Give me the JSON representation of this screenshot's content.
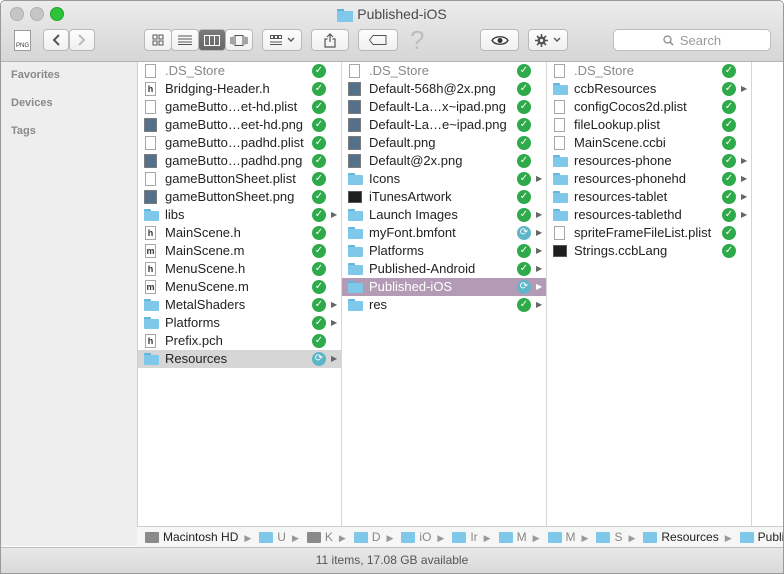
{
  "window": {
    "title": "Published-iOS"
  },
  "toolbar": {
    "search_placeholder": "Search",
    "doc_badge": "PNG",
    "help": "?"
  },
  "sidebar": {
    "sections": [
      "Favorites",
      "Devices",
      "Tags"
    ]
  },
  "columns": [
    {
      "items": [
        {
          "name": ".DS_Store",
          "icon": "doc",
          "status": "ok",
          "dim": true
        },
        {
          "name": "Bridging-Header.h",
          "icon": "h-doc",
          "status": "ok"
        },
        {
          "name": "gameButto…et-hd.plist",
          "icon": "plist-doc",
          "status": "ok"
        },
        {
          "name": "gameButto…eet-hd.png",
          "icon": "image",
          "status": "ok"
        },
        {
          "name": "gameButto…padhd.plist",
          "icon": "plist-doc",
          "status": "ok"
        },
        {
          "name": "gameButto…padhd.png",
          "icon": "image",
          "status": "ok"
        },
        {
          "name": "gameButtonSheet.plist",
          "icon": "plist-doc",
          "status": "ok"
        },
        {
          "name": "gameButtonSheet.png",
          "icon": "image",
          "status": "ok"
        },
        {
          "name": "libs",
          "icon": "folder",
          "status": "ok",
          "arrow": true
        },
        {
          "name": "MainScene.h",
          "icon": "h-doc",
          "status": "ok"
        },
        {
          "name": "MainScene.m",
          "icon": "m-doc",
          "status": "ok"
        },
        {
          "name": "MenuScene.h",
          "icon": "h-doc",
          "status": "ok"
        },
        {
          "name": "MenuScene.m",
          "icon": "m-doc",
          "status": "ok"
        },
        {
          "name": "MetalShaders",
          "icon": "folder",
          "status": "ok",
          "arrow": true
        },
        {
          "name": "Platforms",
          "icon": "folder",
          "status": "ok",
          "arrow": true
        },
        {
          "name": "Prefix.pch",
          "icon": "h-doc",
          "status": "ok"
        },
        {
          "name": "Resources",
          "icon": "folder",
          "status": "sync",
          "arrow": true,
          "selected": "inactive"
        }
      ]
    },
    {
      "items": [
        {
          "name": ".DS_Store",
          "icon": "doc",
          "status": "ok",
          "dim": true
        },
        {
          "name": "Default-568h@2x.png",
          "icon": "image",
          "status": "ok"
        },
        {
          "name": "Default-La…x~ipad.png",
          "icon": "image",
          "status": "ok"
        },
        {
          "name": "Default-La…e~ipad.png",
          "icon": "image",
          "status": "ok"
        },
        {
          "name": "Default.png",
          "icon": "image",
          "status": "ok"
        },
        {
          "name": "Default@2x.png",
          "icon": "image",
          "status": "ok"
        },
        {
          "name": "Icons",
          "icon": "folder",
          "status": "ok",
          "arrow": true
        },
        {
          "name": "iTunesArtwork",
          "icon": "black",
          "status": "ok"
        },
        {
          "name": "Launch Images",
          "icon": "folder",
          "status": "ok",
          "arrow": true
        },
        {
          "name": "myFont.bmfont",
          "icon": "folder",
          "status": "sync",
          "arrow": true
        },
        {
          "name": "Platforms",
          "icon": "folder",
          "status": "ok",
          "arrow": true
        },
        {
          "name": "Published-Android",
          "icon": "folder",
          "status": "ok",
          "arrow": true
        },
        {
          "name": "Published-iOS",
          "icon": "folder",
          "status": "sync",
          "arrow": true,
          "selected": "active"
        },
        {
          "name": "res",
          "icon": "folder",
          "status": "ok",
          "arrow": true
        }
      ]
    },
    {
      "items": [
        {
          "name": ".DS_Store",
          "icon": "doc",
          "status": "ok",
          "dim": true
        },
        {
          "name": "ccbResources",
          "icon": "folder",
          "status": "ok",
          "arrow": true
        },
        {
          "name": "configCocos2d.plist",
          "icon": "doc",
          "status": "ok"
        },
        {
          "name": "fileLookup.plist",
          "icon": "doc",
          "status": "ok"
        },
        {
          "name": "MainScene.ccbi",
          "icon": "doc",
          "status": "ok"
        },
        {
          "name": "resources-phone",
          "icon": "folder",
          "status": "ok",
          "arrow": true
        },
        {
          "name": "resources-phonehd",
          "icon": "folder",
          "status": "ok",
          "arrow": true
        },
        {
          "name": "resources-tablet",
          "icon": "folder",
          "status": "ok",
          "arrow": true
        },
        {
          "name": "resources-tablethd",
          "icon": "folder",
          "status": "ok",
          "arrow": true
        },
        {
          "name": "spriteFrameFileList.plist",
          "icon": "doc",
          "status": "ok"
        },
        {
          "name": "Strings.ccbLang",
          "icon": "black",
          "status": "ok"
        }
      ]
    }
  ],
  "pathbar": {
    "disk": "Macintosh HD",
    "crumbs": [
      "U",
      "K",
      "D",
      "iO",
      "Ir",
      "M",
      "M",
      "S",
      "Resources",
      "Published-iOS"
    ]
  },
  "status": {
    "text": "11 items, 17.08 GB available"
  }
}
